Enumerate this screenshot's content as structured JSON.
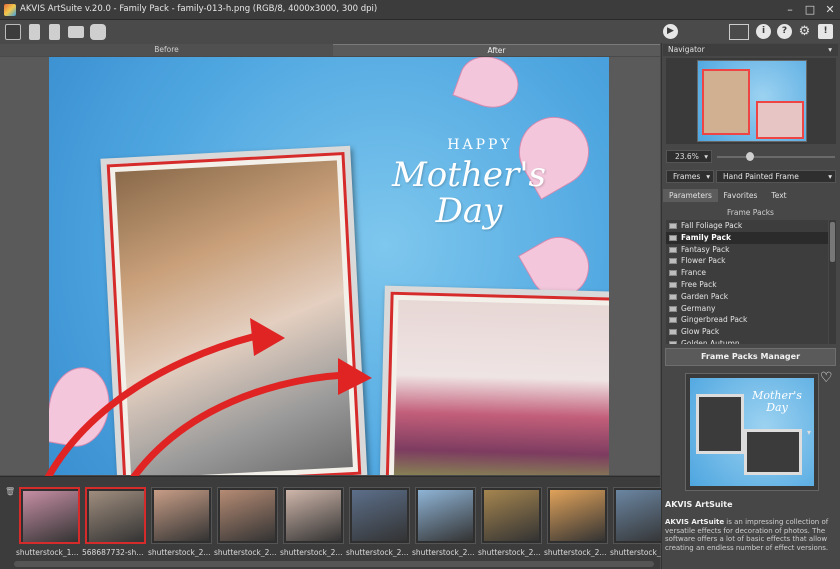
{
  "window": {
    "title": "AKVIS ArtSuite v.20.0 - Family Pack - family-013-h.png (RGB/8, 4000x3000, 300 dpi)"
  },
  "toolbar": {
    "left_icons": [
      "open-icon",
      "save-icon",
      "export-icon",
      "print-icon",
      "share-icon"
    ],
    "right_icons": [
      "run-icon",
      "panel-layout-icon",
      "info-icon",
      "help-icon",
      "settings-icon",
      "feedback-icon"
    ]
  },
  "view_tabs": {
    "before": "Before",
    "after": "After"
  },
  "canvas": {
    "happy": "HAPPY",
    "script_line1": "Mother's",
    "script_line2": "Day"
  },
  "filmstrip": {
    "items": [
      {
        "label": "shutterstock_1...",
        "selected": true,
        "color": "#c68ea4"
      },
      {
        "label": "568687732-sh...",
        "selected": true,
        "color": "#9f8d7e"
      },
      {
        "label": "shutterstock_2...",
        "selected": false,
        "color": "#c79d86"
      },
      {
        "label": "shutterstock_2...",
        "selected": false,
        "color": "#b58b74"
      },
      {
        "label": "shutterstock_2...",
        "selected": false,
        "color": "#cfb6aa"
      },
      {
        "label": "shutterstock_2...",
        "selected": false,
        "color": "#5c6f8a"
      },
      {
        "label": "shutterstock_2...",
        "selected": false,
        "color": "#8fb4d6"
      },
      {
        "label": "shutterstock_2...",
        "selected": false,
        "color": "#a5854f"
      },
      {
        "label": "shutterstock_2...",
        "selected": false,
        "color": "#e0a25a"
      },
      {
        "label": "shutterstock_2...",
        "selected": false,
        "color": "#6b86a2"
      }
    ]
  },
  "navigator": {
    "title": "Navigator",
    "zoom": "23.6%"
  },
  "frames": {
    "category": "Frames",
    "frame": "Hand Painted Frame"
  },
  "param_tabs": {
    "parameters": "Parameters",
    "favorites": "Favorites",
    "text": "Text"
  },
  "packs": {
    "title": "Frame Packs",
    "items": [
      "Fall Foliage Pack",
      "Family Pack",
      "Fantasy Pack",
      "Flower Pack",
      "France",
      "Free Pack",
      "Garden Pack",
      "Germany",
      "Gingerbread Pack",
      "Glow Pack",
      "Golden Autumn"
    ],
    "selected": "Family Pack",
    "manager_button": "Frame Packs Manager"
  },
  "preview": {
    "title_text": "Mother's Day"
  },
  "info": {
    "title": "AKVIS ArtSuite",
    "bold": "AKVIS ArtSuite",
    "text": " is an impressing collection of versatile effects for decoration of photos. The software offers a lot of basic effects that allow creating an endless number of effect versions."
  }
}
